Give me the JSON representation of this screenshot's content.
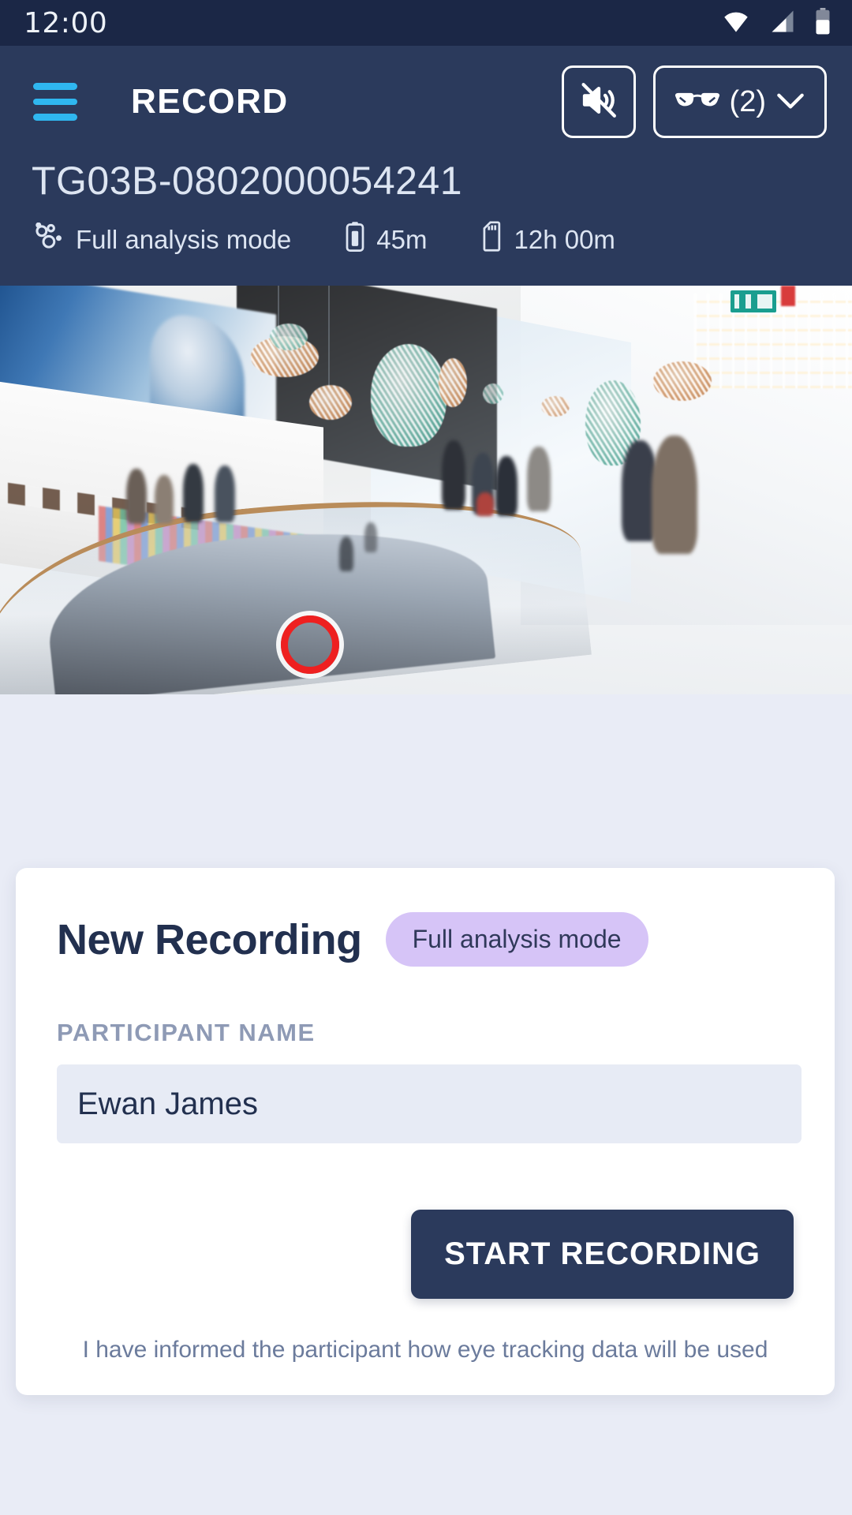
{
  "status_bar": {
    "time": "12:00",
    "icons": [
      "wifi-icon",
      "cellular-signal-icon",
      "battery-icon"
    ]
  },
  "header": {
    "menu_icon": "hamburger-menu-icon",
    "title": "RECORD",
    "mute_button": {
      "icon": "speaker-muted-icon"
    },
    "glasses_button": {
      "icon": "glasses-icon",
      "count_label": "(2)",
      "chevron": "chevron-down-icon"
    },
    "device": {
      "serial": "TG03B-0802000054241",
      "meta": [
        {
          "icon": "analysis-mode-icon",
          "label": "Full analysis mode"
        },
        {
          "icon": "battery-icon",
          "label": "45m"
        },
        {
          "icon": "sd-card-icon",
          "label": "12h 00m"
        }
      ]
    }
  },
  "live_view": {
    "scene_description": "Shopping mall interior live camera view",
    "gaze_marker": {
      "name": "gaze-marker",
      "color": "#ee2020"
    }
  },
  "card": {
    "title": "New Recording",
    "mode_badge": "Full analysis mode",
    "participant_label": "PARTICIPANT NAME",
    "participant_value": "Ewan James",
    "participant_placeholder": "Participant name",
    "start_button": "START RECORDING",
    "consent_text": "I have informed the participant how eye tracking data will be used"
  },
  "colors": {
    "status_bar_bg": "#1b2746",
    "header_bg": "#2b3a5c",
    "page_bg": "#e9ecf6",
    "accent_cyan": "#2fb7f0",
    "badge_purple": "#d6c4f7",
    "input_bg": "#e7ebf5",
    "gaze_red": "#ee2020"
  }
}
